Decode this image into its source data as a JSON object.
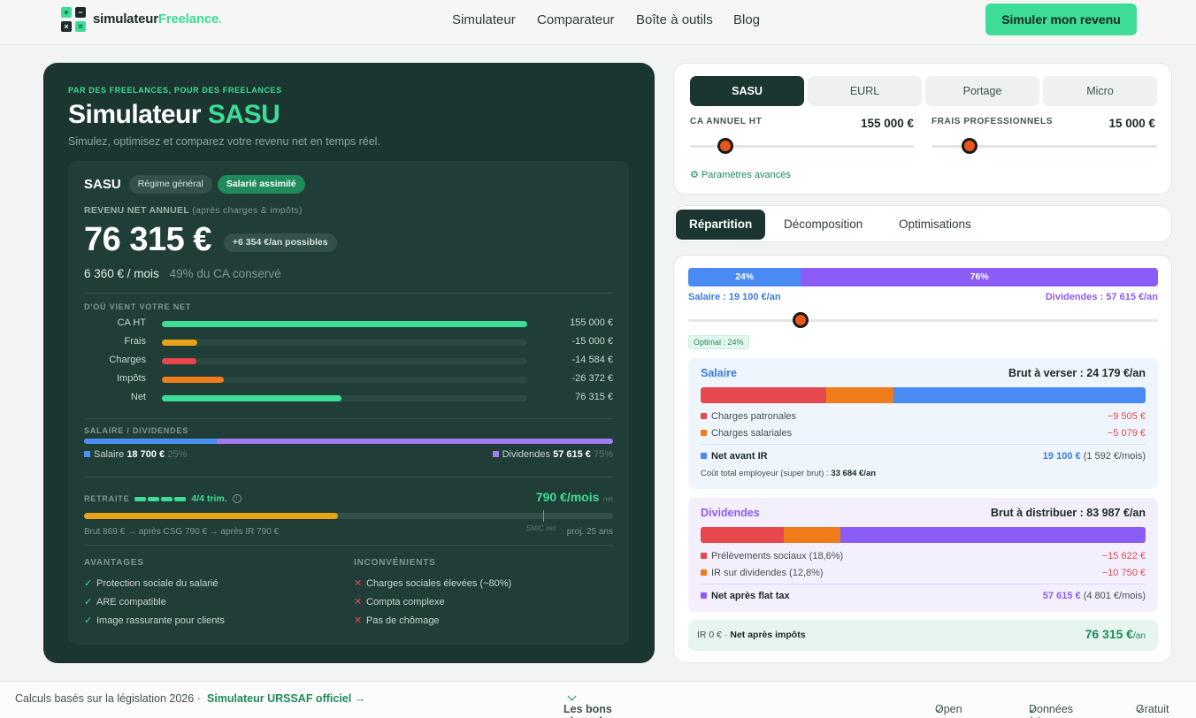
{
  "header": {
    "brand_a": "simulateur",
    "brand_b": "Freelance",
    "brand_c": ".",
    "nav": [
      "Simulateur",
      "Comparateur",
      "Boîte à outils",
      "Blog"
    ],
    "cta": "Simuler mon revenu"
  },
  "hero": {
    "eyebrow": "PAR DES FREELANCES, POUR DES FREELANCES",
    "title_a": "Simulateur",
    "title_b": "SASU",
    "subtitle": "Simulez, optimisez et comparez votre revenu net en temps réel."
  },
  "summary": {
    "status": "SASU",
    "chip1": "Régime général",
    "chip2": "Salarié assimilé",
    "net_label": "REVENU NET ANNUEL",
    "net_label_note": "(après charges & impôts)",
    "net_amount": "76 315 €",
    "gain_chip": "+6 354 €/an possibles",
    "monthly": "6 360 € / mois",
    "kept": "49% du CA conservé",
    "source_title": "D'OÙ VIENT VOTRE NET",
    "sources": [
      {
        "label": "CA HT",
        "value": "155 000 €",
        "ratio": 1.0,
        "color": "#3ddc97"
      },
      {
        "label": "Frais",
        "value": "-15 000 €",
        "ratio": 0.097,
        "color": "#e8a317"
      },
      {
        "label": "Charges",
        "value": "-14 584 €",
        "ratio": 0.094,
        "color": "#e5484d"
      },
      {
        "label": "Impôts",
        "value": "-26 372 €",
        "ratio": 0.17,
        "color": "#f07b1a"
      },
      {
        "label": "Net",
        "value": "76 315 €",
        "ratio": 0.492,
        "color": "#3ddc97"
      }
    ],
    "split_title": "SALAIRE / DIVIDENDES",
    "split_salary_label": "Salaire",
    "split_salary_value": "18 700 €",
    "split_salary_pct": "25%",
    "split_div_label": "Dividendes",
    "split_div_value": "57 615 €",
    "split_div_pct": "75%",
    "split_salary_ratio": 0.25,
    "retraite_title": "RETRAITE",
    "retraite_trim": "4/4 trim.",
    "retraite_amount": "790 €/mois",
    "retraite_unit": "net",
    "retraite_progress": 0.48,
    "retraite_detail": "Brut 869 € → après CSG 790 € → après IR 790 €",
    "retraite_smic": "SMIC net",
    "retraite_proj": "proj. 25 ans",
    "info_icon": "info-icon",
    "pros_title": "AVANTAGES",
    "pros": [
      "Protection sociale du salarié",
      "ARE compatible",
      "Image rassurante pour clients"
    ],
    "cons_title": "INCONVÉNIENTS",
    "cons": [
      "Charges sociales élevées (~80%)",
      "Compta complexe",
      "Pas de chômage"
    ]
  },
  "controls": {
    "statuses": [
      "SASU",
      "EURL",
      "Portage",
      "Micro"
    ],
    "ca_label": "CA ANNUEL HT",
    "ca_value": "155 000 €",
    "ca_level": 0.16,
    "frais_label": "FRAIS PROFESSIONNELS",
    "frais_value": "15 000 €",
    "frais_level": 0.17,
    "advanced": "Paramètres avancés"
  },
  "tabs": [
    "Répartition",
    "Décomposition",
    "Optimisations"
  ],
  "repartition": {
    "salary_pct": "24%",
    "div_pct": "76%",
    "salary_ratio": 0.24,
    "salary_line": "Salaire : 19 100 €/an",
    "div_line": "Dividendes : 57 615 €/an",
    "optimal": "Optimal : 24%",
    "salaire": {
      "title": "Salaire",
      "brut": "Brut à verser : 24 179 €/an",
      "segments": [
        0.282,
        0.151,
        0.567
      ],
      "lines": [
        {
          "label": "Charges patronales",
          "value": "−9 505 €"
        },
        {
          "label": "Charges salariales",
          "value": "−5 079 €"
        }
      ],
      "net_label": "Net avant IR",
      "net_value": "19 100 €",
      "net_month": "(1 592 €/mois)",
      "cost_label": "Coût total employeur (super brut) :",
      "cost_value": "33 684 €/an"
    },
    "dividendes": {
      "title": "Dividendes",
      "brut": "Brut à distribuer : 83 987 €/an",
      "segments": [
        0.186,
        0.128,
        0.686
      ],
      "lines": [
        {
          "label": "Prélèvements sociaux (18,6%)",
          "value": "−15 622 €"
        },
        {
          "label": "IR sur dividendes (12,8%)",
          "value": "−10 750 €"
        }
      ],
      "net_label": "Net après flat tax",
      "net_value": "57 615 €",
      "net_month": "(4 801 €/mois)"
    },
    "total_ir": "IR 0 € ·",
    "total_label": "Net après impôts",
    "total_value": "76 315 €",
    "total_unit": "/an"
  },
  "footer": {
    "legal": "Calculs basés sur la législation 2026 ·",
    "urssaf": "Simulateur URSSAF officiel →",
    "deals": "Les bons plans du freelance",
    "badges": [
      "Open source",
      "Données à jour",
      "Gratuit"
    ]
  }
}
